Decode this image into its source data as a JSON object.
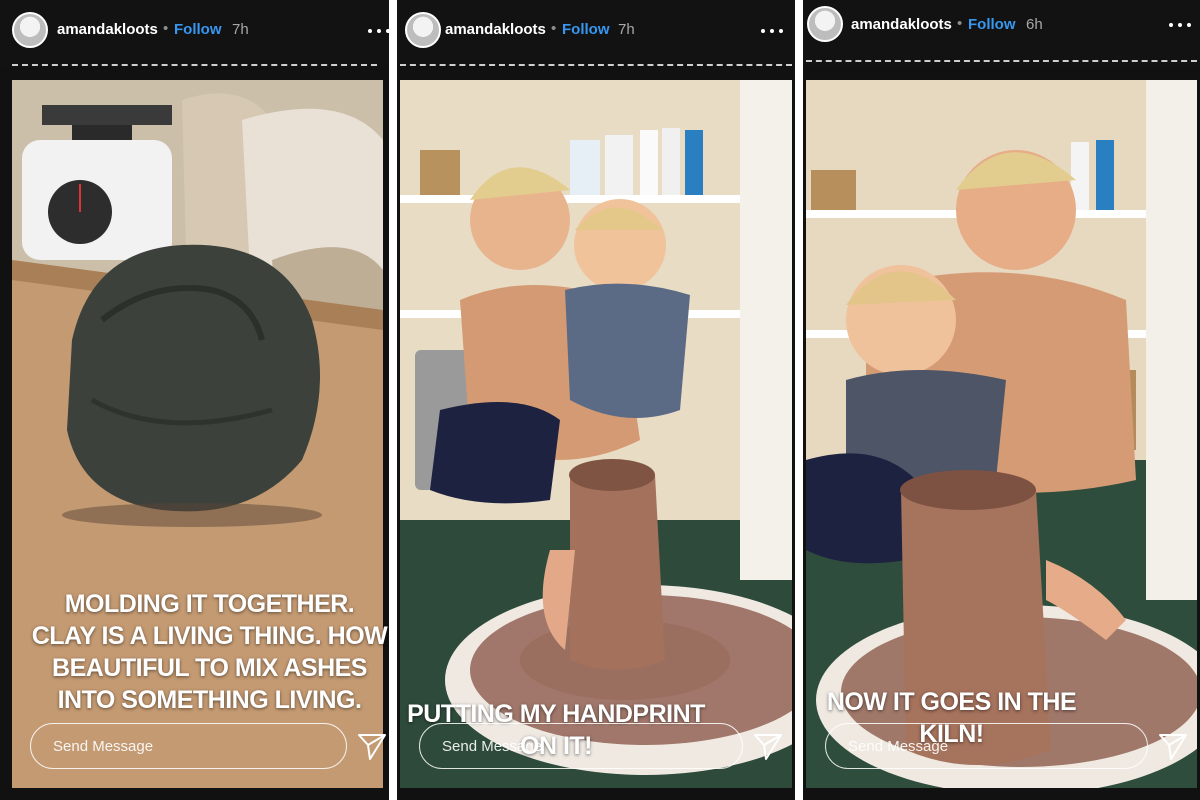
{
  "stories": [
    {
      "username": "amandakloots",
      "separator": "•",
      "follow_label": "Follow",
      "time": "7h",
      "caption": "MOLDING IT TOGETHER. CLAY IS A LIVING THING. HOW BEAUTIFUL TO MIX ASHES INTO SOMETHING LIVING.",
      "send_placeholder": "Send Message"
    },
    {
      "username": "amandakloots",
      "separator": "•",
      "follow_label": "Follow",
      "time": "7h",
      "caption": "PUTTING MY HANDPRINT ON IT!",
      "send_placeholder": "Send Message"
    },
    {
      "username": "amandakloots",
      "separator": "•",
      "follow_label": "Follow",
      "time": "6h",
      "caption": "NOW IT GOES IN THE KILN!",
      "send_placeholder": "Send Message"
    }
  ],
  "icons": {
    "more": "more-options-icon",
    "send": "paper-plane-icon",
    "avatar": "avatar"
  },
  "colors": {
    "follow": "#3897f0",
    "bar_background": "#121212",
    "text": "#ffffff"
  }
}
